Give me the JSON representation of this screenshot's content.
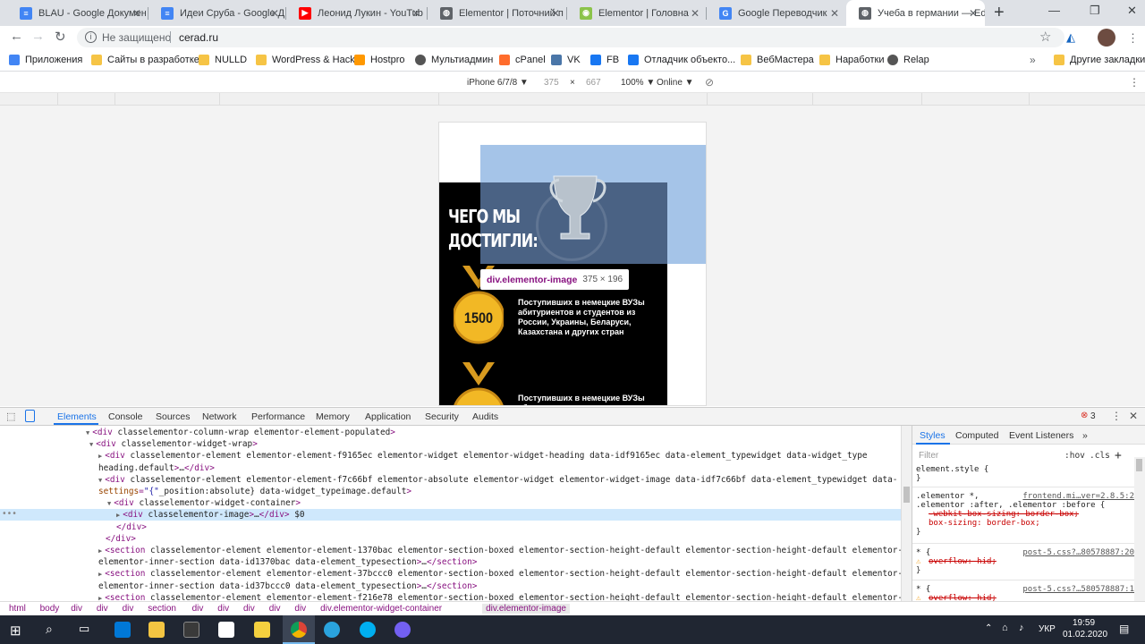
{
  "tabs": [
    {
      "title": "BLAU - Google Докумен",
      "color": "#4285f4",
      "glyph": "≡"
    },
    {
      "title": "Идеи Сруба - Google Д",
      "color": "#4285f4",
      "glyph": "≡"
    },
    {
      "title": "Леонид Лукин - YouTub",
      "color": "#ff0000",
      "glyph": "▶"
    },
    {
      "title": "Elementor | Поточний п",
      "color": "#5f6368",
      "glyph": "◍"
    },
    {
      "title": "Elementor | Головна",
      "color": "#8bc34a",
      "glyph": "◉"
    },
    {
      "title": "Google Переводчик",
      "color": "#4285f4",
      "glyph": "G"
    },
    {
      "title": "Учеба в германии — Ed",
      "color": "#5f6368",
      "glyph": "◍",
      "active": true
    }
  ],
  "address": {
    "security": "Не защищено",
    "url": "cerad.ru"
  },
  "bookmarks": [
    {
      "label": "Приложения",
      "icon": "apps-grid-icon"
    },
    {
      "label": "Сайты в разработке",
      "icon": "folder-icon"
    },
    {
      "label": "NULLD",
      "icon": "folder-icon"
    },
    {
      "label": "WordPress & Hacks",
      "icon": "folder-icon"
    },
    {
      "label": "Hostpro",
      "icon": "hostpro-icon"
    },
    {
      "label": "Мультиадмин",
      "icon": "globe-icon"
    },
    {
      "label": "cPanel",
      "icon": "cpanel-icon"
    },
    {
      "label": "VK",
      "icon": "vk-icon"
    },
    {
      "label": "FB",
      "icon": "facebook-icon"
    },
    {
      "label": "Отладчик объекто...",
      "icon": "facebook-icon"
    },
    {
      "label": "ВебМастера",
      "icon": "folder-icon"
    },
    {
      "label": "Наработки",
      "icon": "folder-icon"
    },
    {
      "label": "Relap",
      "icon": "globe-icon"
    }
  ],
  "other_bookmarks": "Другие закладки",
  "device": {
    "name": "iPhone 6/7/8 ▼",
    "width": "375",
    "x": "×",
    "height": "667",
    "zoom": "100% ▼",
    "network": "Online ▼"
  },
  "page": {
    "heading_line1": "ЧЕГО МЫ",
    "heading_line2": "ДОСТИГЛИ:",
    "medal1_value": "1500",
    "medal1_text": "Поступивших в немецкие ВУЗы абитуриентов и студентов из России, Украины, Беларуси, Казахстана и других стран",
    "medal2_text": "Поступивших в немецкие ВУЗы абитуриентов и студентов из",
    "tooltip_selector": "div.elementor-image",
    "tooltip_size": "375 × 196"
  },
  "devtools": {
    "tabs": [
      "Elements",
      "Console",
      "Sources",
      "Network",
      "Performance",
      "Memory",
      "Application",
      "Security",
      "Audits"
    ],
    "error_count": "3",
    "side_tabs": [
      "Styles",
      "Computed",
      "Event Listeners",
      "»"
    ],
    "filter_placeholder": "Filter",
    "hov": ":hov",
    "cls": ".cls",
    "breadcrumbs": [
      "html",
      "body",
      "div",
      "div",
      "div",
      "section",
      "div",
      "div",
      "div",
      "div",
      "div",
      "div.elementor-widget-container",
      "div.elementor-image"
    ]
  },
  "dom_lines": [
    {
      "indent": 96,
      "prefix": "▼",
      "html": "<div class=\"elementor-column-wrap  elementor-element-populated\">"
    },
    {
      "indent": 100,
      "prefix": "▼",
      "html": "<div class=\"elementor-widget-wrap\">"
    },
    {
      "indent": 110,
      "prefix": "▶",
      "html": "<div class=\"elementor-element elementor-element-f9165ec elementor-widget elementor-widget-heading\" data-id=\"f9165ec\" data-element_type=\"widget\" data-widget_type="
    },
    {
      "indent": 110,
      "prefix": "",
      "html": "\"heading.default\">…</div>"
    },
    {
      "indent": 110,
      "prefix": "▼",
      "html": "<div class=\"elementor-element elementor-element-f7c66bf elementor-absolute elementor-widget elementor-widget-image\" data-id=\"f7c66bf\" data-element_type=\"widget\" data-"
    },
    {
      "indent": 110,
      "prefix": "",
      "html": "settings=\"{\"_position\":\"absolute\"}\" data-widget_type=\"image.default\">"
    },
    {
      "indent": 120,
      "prefix": "▼",
      "html": "<div class=\"elementor-widget-container\">"
    },
    {
      "indent": 130,
      "prefix": "▶",
      "html": "<div class=\"elementor-image\">…</div> == $0",
      "selected": true
    },
    {
      "indent": 130,
      "prefix": "",
      "html": "</div>"
    },
    {
      "indent": 118,
      "prefix": "",
      "html": "</div>"
    },
    {
      "indent": 110,
      "prefix": "▶",
      "html": "<section class=\"elementor-element elementor-element-1370bac elementor-section-boxed elementor-section-height-default elementor-section-height-default elementor-section"
    },
    {
      "indent": 110,
      "prefix": "",
      "html": "elementor-inner-section\" data-id=\"1370bac\" data-element_type=\"section\">…</section>"
    },
    {
      "indent": 110,
      "prefix": "▶",
      "html": "<section class=\"elementor-element elementor-element-37bccc0 elementor-section-boxed elementor-section-height-default elementor-section-height-default elementor-section"
    },
    {
      "indent": 110,
      "prefix": "",
      "html": "elementor-inner-section\" data-id=\"37bccc0\" data-element_type=\"section\">…</section>"
    },
    {
      "indent": 110,
      "prefix": "▶",
      "html": "<section class=\"elementor-element elementor-element-f216e78 elementor-section-boxed elementor-section-height-default elementor-section-height-default elementor-section"
    }
  ],
  "styles": [
    {
      "sel": "element.style {",
      "src": "",
      "props": [],
      "close": "}"
    },
    {
      "sel": ".elementor *,",
      "src": "frontend.mi…ver=2.8.5:2",
      "sel2": ".elementor :after, .elementor :before {",
      "props": [
        {
          "t": "-webkit-box-sizing: border-box;",
          "strike": true
        },
        {
          "t": "box-sizing: border-box;",
          "strike": false
        }
      ],
      "close": "}"
    },
    {
      "sel": "* {",
      "src": "post-5.css?…80578887:20",
      "props": [
        {
          "t": "overflow: hid;",
          "strike": true,
          "warn": true
        }
      ],
      "close": "}"
    },
    {
      "sel": "* {",
      "src": "post-5.css?…580578887:1",
      "props": [
        {
          "t": "overflow: hid;",
          "strike": true,
          "warn": true
        }
      ],
      "close": ""
    }
  ],
  "taskbar": {
    "lang": "УКР",
    "time": "19:59",
    "date": "01.02.2020"
  }
}
